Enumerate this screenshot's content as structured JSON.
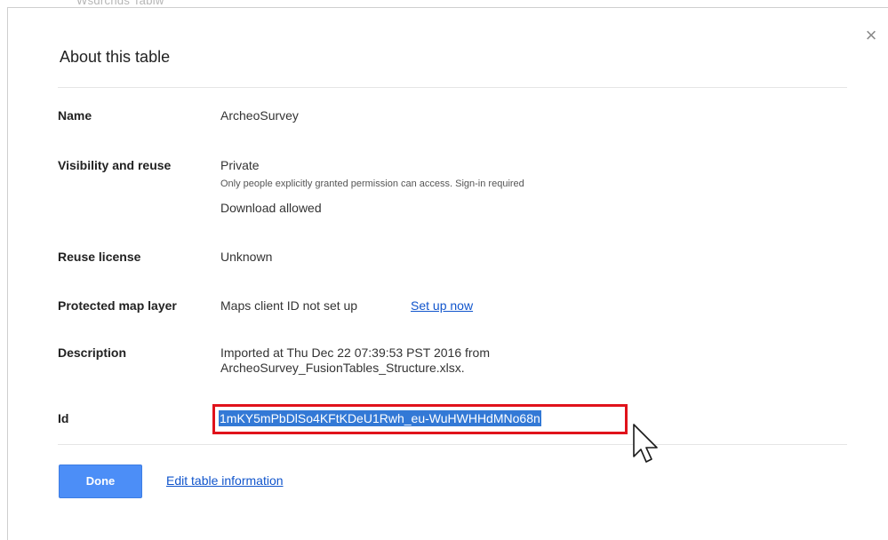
{
  "background_text": "Wsdrcnds Tabiw",
  "dialog": {
    "title": "About this table",
    "close_icon": "×"
  },
  "fields": {
    "name": {
      "label": "Name",
      "value": "ArcheoSurvey"
    },
    "visibility": {
      "label": "Visibility and reuse",
      "value": "Private",
      "note": "Only people explicitly granted permission can access. Sign-in required",
      "download": "Download allowed"
    },
    "license": {
      "label": "Reuse license",
      "value": "Unknown"
    },
    "map_layer": {
      "label": "Protected map layer",
      "value": "Maps client ID not set up",
      "link": "Set up now"
    },
    "description": {
      "label": "Description",
      "line1": "Imported at Thu Dec 22 07:39:53 PST 2016 from",
      "line2": "ArcheoSurvey_FusionTables_Structure.xlsx."
    },
    "id": {
      "label": "Id",
      "value": "1mKY5mPbDlSo4KFtKDeU1Rwh_eu-WuHWHHdMNo68n"
    }
  },
  "footer": {
    "done_label": "Done",
    "edit_link": "Edit table information"
  },
  "colors": {
    "accent": "#4c8ef7",
    "link": "#1155cc",
    "highlight_border": "#e0121b",
    "selection": "#3379d6"
  }
}
